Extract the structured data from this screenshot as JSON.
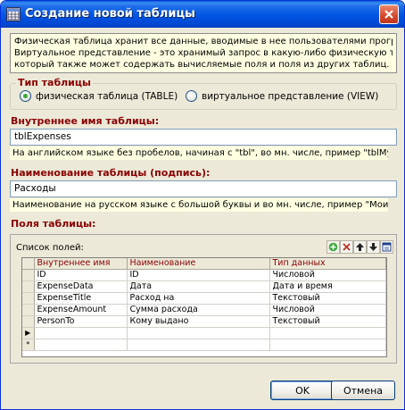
{
  "window": {
    "title": "Создание новой таблицы"
  },
  "info": {
    "line1": "Физическая таблица хранит все данные, вводимые в нее пользователями программы.",
    "line2": "Виртуальное представление - это хранимый запрос в какую-либо физическую таблицу,",
    "line3": "который также может содержать вычисляемые поля и поля из других таблиц."
  },
  "table_type": {
    "title": "Тип таблицы",
    "option_table": "физическая таблица (TABLE)",
    "option_view": "виртуальное представление (VIEW)",
    "selected": "option_table"
  },
  "internal_name": {
    "label": "Внутреннее имя таблицы:",
    "value": "tblExpenses",
    "hint": "На английском языке без пробелов, начиная с \"tbl\", во мн. числе, пример \"tblMyBooks\""
  },
  "display_name": {
    "label": "Наименование таблицы (подпись):",
    "value": "Расходы",
    "hint": "Наименование на русском языке с большой буквы и во мн. числе, пример \"Мои книги\""
  },
  "fields": {
    "title": "Поля таблицы:",
    "list_caption": "Список полей:",
    "toolbar_icons": [
      "add-icon",
      "delete-icon",
      "move-up-icon",
      "move-down-icon",
      "properties-icon"
    ],
    "columns": [
      "Внутреннее имя",
      "Наименование",
      "Тип данных"
    ],
    "rows": [
      [
        "ID",
        "ID",
        "Числовой"
      ],
      [
        "ExpenseData",
        "Дата",
        "Дата и время"
      ],
      [
        "ExpenseTitle",
        "Расход на",
        "Текстовый"
      ],
      [
        "ExpenseAmount",
        "Сумма расхода",
        "Числовой"
      ],
      [
        "PersonTo",
        "Кому выдано",
        "Текстовый"
      ]
    ],
    "current_row_marker": "▶",
    "new_row_marker": "*"
  },
  "buttons": {
    "ok": "OK",
    "cancel": "Отмена"
  },
  "colors": {
    "section_title": "#8b0000",
    "hint_bg": "#ffffe1",
    "dialog_bg": "#ece9d8",
    "titlebar": "#0054e3"
  }
}
